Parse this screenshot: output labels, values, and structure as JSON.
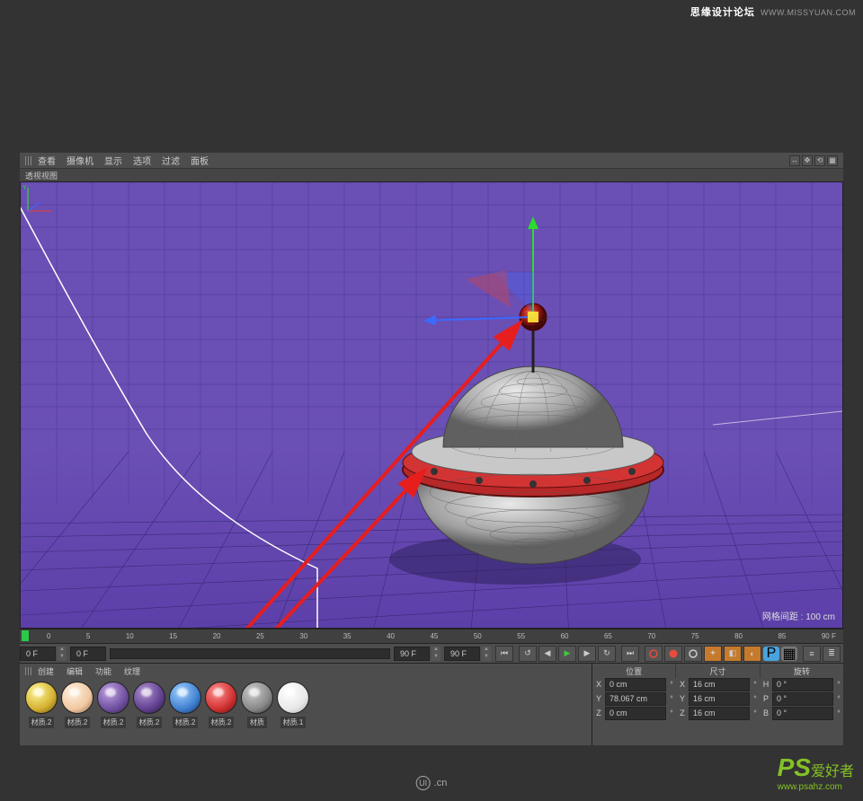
{
  "watermarks": {
    "top_title": "思缘设计论坛",
    "top_url": "WWW.MISSYUAN.COM",
    "bottom_center_prefix": "UI",
    "bottom_center_suffix": ".cn",
    "bottom_right_ps": "PS",
    "bottom_right_text": "爱好者",
    "bottom_right_url": "www.psahz.com"
  },
  "viewport_menu": [
    "查看",
    "摄像机",
    "显示",
    "选项",
    "过滤",
    "面板"
  ],
  "viewport_title": "透视视图",
  "grid_info": "网格间距 : 100 cm",
  "timeline": {
    "ticks": [
      "0",
      "5",
      "10",
      "15",
      "20",
      "25",
      "30",
      "35",
      "40",
      "45",
      "50",
      "55",
      "60",
      "65",
      "70",
      "75",
      "80",
      "85",
      "90 F"
    ]
  },
  "transport": {
    "start_frame": "0 F",
    "range_start": "0 F",
    "range_end": "90 F",
    "end_frame": "90 F"
  },
  "materials_menu": [
    "创建",
    "编辑",
    "功能",
    "纹理"
  ],
  "materials": [
    {
      "name": "材质.2",
      "color": "radial-gradient(circle at 35% 30%, #fff89a, #d4b030 60%, #6a5010)"
    },
    {
      "name": "材质.2",
      "color": "radial-gradient(circle at 35% 30%, #fff0e0, #f0c8a0 60%, #8a6040)"
    },
    {
      "name": "材质.2",
      "color": "radial-gradient(circle at 35% 30%, #c0a0e0, #7050a0 60%, #302050)"
    },
    {
      "name": "材质.2",
      "color": "radial-gradient(circle at 35% 30%, #b090d0, #604090 60%, #281840)"
    },
    {
      "name": "材质.2",
      "color": "radial-gradient(circle at 35% 30%, #a0d0ff, #4080d0 60%, #103060)"
    },
    {
      "name": "材质.2",
      "color": "radial-gradient(circle at 35% 30%, #ff9090, #d03030 60%, #601010)"
    },
    {
      "name": "材质",
      "color": "radial-gradient(circle at 35% 30%, #ccc, #888 60%, #333)"
    },
    {
      "name": "材质.1",
      "color": "radial-gradient(circle at 35% 30%, #fff, #e8e8e8 60%, #aaa)"
    }
  ],
  "coords": {
    "headers": [
      "位置",
      "尺寸",
      "旋转"
    ],
    "rows": [
      {
        "axis": "X",
        "pos": "0 cm",
        "sizeLbl": "X",
        "size": "16 cm",
        "rotLbl": "H",
        "rot": "0 °"
      },
      {
        "axis": "Y",
        "pos": "78.067 cm",
        "sizeLbl": "Y",
        "size": "16 cm",
        "rotLbl": "P",
        "rot": "0 °"
      },
      {
        "axis": "Z",
        "pos": "0 cm",
        "sizeLbl": "Z",
        "size": "16 cm",
        "rotLbl": "B",
        "rot": "0 °"
      }
    ]
  }
}
